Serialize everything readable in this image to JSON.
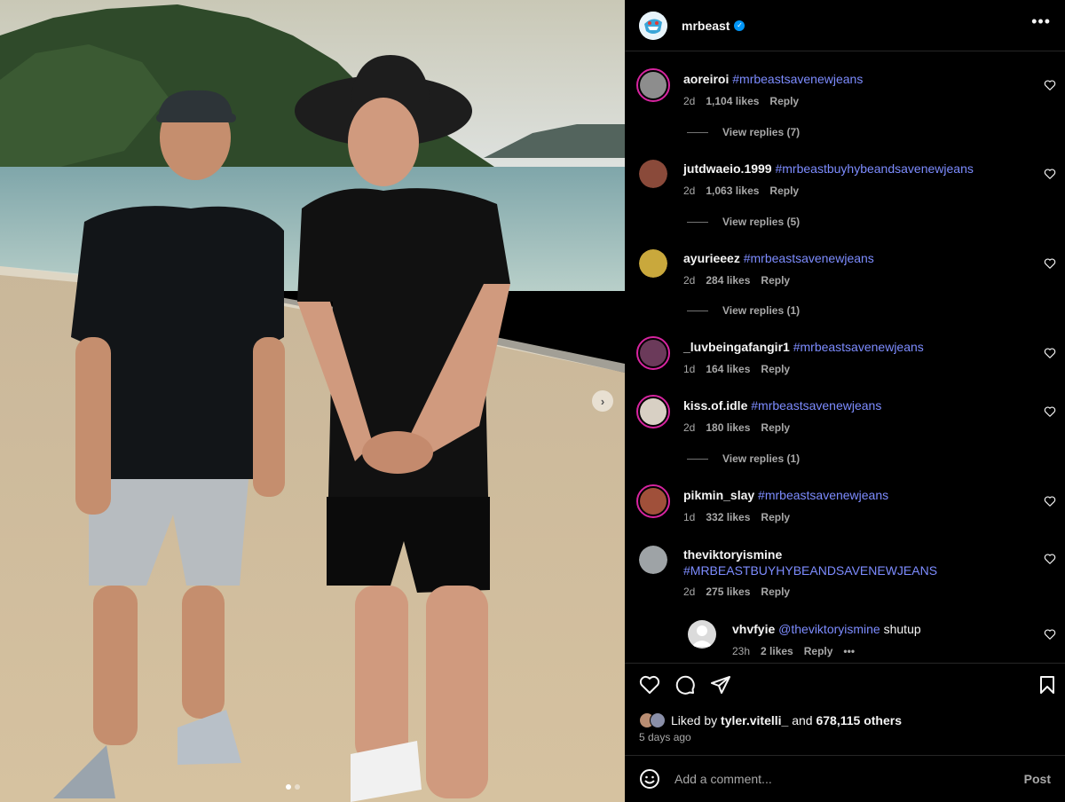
{
  "post": {
    "username": "mrbeast",
    "more_label": "•••"
  },
  "comments": [
    {
      "user": "aoreiroi",
      "text": "#mrbeastsavenewjeans",
      "time": "2d",
      "likes": "1,104 likes",
      "reply": "Reply",
      "view_replies": "View replies (7)"
    },
    {
      "user": "jutdwaeio.1999",
      "text": "#mrbeastbuyhybeandsavenewjeans",
      "time": "2d",
      "likes": "1,063 likes",
      "reply": "Reply",
      "view_replies": "View replies (5)"
    },
    {
      "user": "ayurieeez",
      "text": "#mrbeastsavenewjeans",
      "time": "2d",
      "likes": "284 likes",
      "reply": "Reply",
      "view_replies": "View replies (1)"
    },
    {
      "user": "_luvbeingafangir1",
      "text": "#mrbeastsavenewjeans",
      "time": "1d",
      "likes": "164 likes",
      "reply": "Reply"
    },
    {
      "user": "kiss.of.idle",
      "text": "#mrbeastsavenewjeans",
      "time": "2d",
      "likes": "180 likes",
      "reply": "Reply",
      "view_replies": "View replies (1)"
    },
    {
      "user": "pikmin_slay",
      "text": "#mrbeastsavenewjeans",
      "time": "1d",
      "likes": "332 likes",
      "reply": "Reply"
    },
    {
      "user": "theviktoryismine",
      "text": "#MRBEASTBUYHYBEANDSAVENEWJEANS",
      "time": "2d",
      "likes": "275 likes",
      "reply": "Reply"
    }
  ],
  "reply": {
    "user": "vhvfyie",
    "mention": "@theviktoryismine",
    "text": "shutup",
    "time": "23h",
    "likes": "2 likes",
    "reply": "Reply",
    "more": "•••"
  },
  "likes": {
    "prefix": "Liked by",
    "user": "tyler.vitelli_",
    "and": "and",
    "others": "678,115 others"
  },
  "time_ago": "5 days ago",
  "add_comment": {
    "placeholder": "Add a comment...",
    "post_label": "Post"
  },
  "photo": {
    "next_arrow": "›"
  },
  "colors": {
    "accent": "#0095f6",
    "hashtag": "#7d8cff",
    "panel_bg": "#000000"
  },
  "icons": [
    "heart-icon",
    "comment-icon",
    "share-icon",
    "bookmark-icon",
    "emoji-icon",
    "verified-icon",
    "more-icon"
  ]
}
